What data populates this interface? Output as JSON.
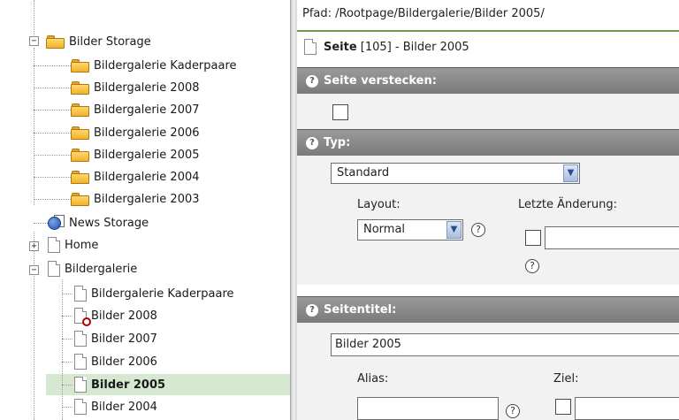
{
  "tree": {
    "items": [
      {
        "label": "Bilder Storage"
      },
      {
        "label": "Bildergalerie Kaderpaare"
      },
      {
        "label": "Bildergalerie 2008"
      },
      {
        "label": "Bildergalerie 2007"
      },
      {
        "label": "Bildergalerie 2006"
      },
      {
        "label": "Bildergalerie 2005"
      },
      {
        "label": "Bildergalerie 2004"
      },
      {
        "label": "Bildergalerie 2003"
      },
      {
        "label": "News Storage"
      },
      {
        "label": "Home"
      },
      {
        "label": "Bildergalerie"
      },
      {
        "label": "Bildergalerie Kaderpaare"
      },
      {
        "label": "Bilder 2008"
      },
      {
        "label": "Bilder 2007"
      },
      {
        "label": "Bilder 2006"
      },
      {
        "label": "Bilder 2005"
      },
      {
        "label": "Bilder 2004"
      }
    ],
    "expander_collapse": "−",
    "expander_expand": "+"
  },
  "breadcrumb": "Pfad: /Rootpage/Bildergalerie/Bilder 2005/",
  "page_header": {
    "type_label": "Seite",
    "rest": " [105] - Bilder 2005"
  },
  "sections": {
    "hide": {
      "title": "Seite verstecken:"
    },
    "type": {
      "title": "Typ:",
      "value": "Standard",
      "layout_label": "Layout:",
      "layout_value": "Normal",
      "last_change_label": "Letzte Änderung:",
      "last_change_value": ""
    },
    "title": {
      "title": "Seitentitel:",
      "value": "Bilder 2005",
      "alias_label": "Alias:",
      "alias_value": "",
      "target_label": "Ziel:",
      "target_value": ""
    }
  },
  "icons": {
    "help_glyph": "?",
    "dropdown_glyph": "▼"
  }
}
